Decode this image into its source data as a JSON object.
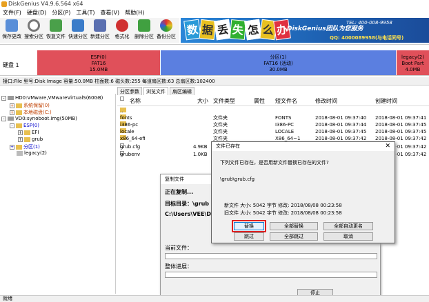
{
  "window": {
    "title": "DiskGenius V4.9.6.564 x64"
  },
  "menu": [
    "文件(F)",
    "硬盘(D)",
    "分区(P)",
    "工具(T)",
    "查看(V)",
    "帮助(H)"
  ],
  "toolbar": [
    {
      "label": "保存更改",
      "icon": "save-icon",
      "color": "#5a8fd8"
    },
    {
      "label": "搜索分区",
      "icon": "search-icon",
      "color": "#777777"
    },
    {
      "label": "恢复文件",
      "icon": "recover-icon",
      "color": "#4aa04a"
    },
    {
      "label": "快速分区",
      "icon": "quick-partition-icon",
      "color": "#3b7cc9"
    },
    {
      "label": "新建分区",
      "icon": "new-partition-icon",
      "color": "#5a6fb0"
    },
    {
      "label": "格式化",
      "icon": "format-icon",
      "color": "#d03030"
    },
    {
      "label": "删除分区",
      "icon": "delete-partition-icon",
      "color": "#40a040"
    },
    {
      "label": "备份分区",
      "icon": "backup-icon",
      "color": "#e09a20"
    }
  ],
  "banner": {
    "chars": [
      "数",
      "据",
      "丢",
      "失",
      "怎",
      "么",
      "办"
    ],
    "brand": "DiskGenius团队为您服务",
    "tel": "TEL: 400-008-9958",
    "qq": "QQ: 4000089958(与电话同号)"
  },
  "disk": {
    "label": "硬盘 1",
    "partitions": [
      {
        "name": "ESP(0)",
        "fs": "FAT16",
        "size": "15.0MB",
        "color": "#e0505a"
      },
      {
        "name": "分区(1)",
        "fs": "FAT16 (活动)",
        "size": "30.0MB",
        "color": "#5b7fe0"
      },
      {
        "name": "legacy(2)",
        "fs": "Boot Part",
        "size": "4.0MB",
        "color": "#e0505a"
      }
    ]
  },
  "info": "接口:File  型号:Disk Image  容量:50.0MB  柱面数:6  磁头数:255  每道扇区数:63  总扇区数:102400",
  "tree": [
    {
      "text": "HD0:VMware,VMwareVirtualS(60GB)",
      "level": 0,
      "exp": "⊟",
      "type": "disk",
      "color": "#000"
    },
    {
      "text": "系统保留(0)",
      "level": 1,
      "exp": "⊞",
      "type": "folder",
      "color": "#c04000"
    },
    {
      "text": "本地磁盘(C:)",
      "level": 1,
      "exp": "⊞",
      "type": "folder",
      "color": "#c04000"
    },
    {
      "text": "VD0:synoboot.img(50MB)",
      "level": 0,
      "exp": "⊟",
      "type": "disk",
      "color": "#000"
    },
    {
      "text": "ESP(0)",
      "level": 1,
      "exp": "⊟",
      "type": "folder",
      "color": "#0000cc"
    },
    {
      "text": "EFI",
      "level": 2,
      "exp": "⊞",
      "type": "folder",
      "color": "#000"
    },
    {
      "text": "grub",
      "level": 2,
      "exp": "⊞",
      "type": "folder",
      "color": "#000"
    },
    {
      "text": "分区(1)",
      "level": 1,
      "exp": "⊞",
      "type": "folder",
      "color": "#0000cc"
    },
    {
      "text": "legacy(2)",
      "level": 1,
      "exp": "",
      "type": "folder",
      "color": "#000"
    }
  ],
  "tabs": [
    "分区参数",
    "浏览文件",
    "扇区编辑"
  ],
  "files": {
    "headers": [
      "名称",
      "大小",
      "文件类型",
      "属性",
      "短文件名",
      "修改时间",
      "创建时间"
    ],
    "rows": [
      [
        "..",
        "",
        "",
        "",
        "",
        "",
        ""
      ],
      [
        "fonts",
        "",
        "文件夹",
        "",
        "FONTS",
        "2018-08-01 09:37:40",
        "2018-08-01 09:37:41"
      ],
      [
        "i386-pc",
        "",
        "文件夹",
        "",
        "I386-PC",
        "2018-08-01 09:37:44",
        "2018-08-01 09:37:45"
      ],
      [
        "locale",
        "",
        "文件夹",
        "",
        "LOCALE",
        "2018-08-01 09:37:45",
        "2018-08-01 09:37:45"
      ],
      [
        "x86_64-efi",
        "",
        "文件夹",
        "",
        "X86_64~1",
        "2018-08-01 09:37:42",
        "2018-08-01 09:37:42"
      ],
      [
        "grub.cfg",
        "4.9KB",
        "",
        "",
        "",
        "",
        "2018-08-01 09:37:42"
      ],
      [
        "grubenv",
        "1.0KB",
        "",
        "",
        "",
        "",
        "2018-08-01 09:37:42"
      ]
    ]
  },
  "copy_dialog": {
    "title": "复制文件",
    "copying": "正在复制...",
    "target_label": "目标目录：\\grub",
    "path": "C:\\Users\\VEE\\Des",
    "current_label": "当前文件：",
    "progress_label": "整体进展：",
    "stop": "停止"
  },
  "exist_dialog": {
    "title": "文件已存在",
    "message": "下列文件已存在，是否用新文件替换已存在的文件?",
    "filename": "\\grub\\grub.cfg",
    "new_line": "新文件  大小: 5042 字节   修改: 2018/08/08 00:23:58",
    "old_line": "旧文件  大小: 5042 字节   修改: 2018/08/08 00:23:58",
    "buttons": [
      "替换",
      "全部替换",
      "全部自动更名",
      "跳过",
      "全部跳过",
      "取消"
    ],
    "close": "✕"
  },
  "status": "就绪"
}
